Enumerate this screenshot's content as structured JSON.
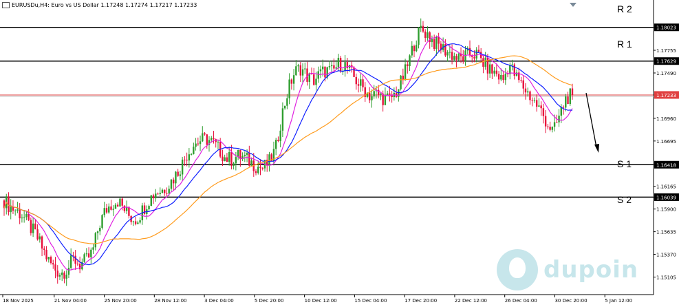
{
  "header": {
    "title": "EURUSDu,H4:  Euro vs US Dollar  1.17248 1.17274 1.17217 1.17233"
  },
  "levels": [
    {
      "label": "R 2",
      "price": 1.18023
    },
    {
      "label": "R 1",
      "price": 1.17629
    },
    {
      "label": "S 1",
      "price": 1.16418
    },
    {
      "label": "S 2",
      "price": 1.16039
    }
  ],
  "logo": {
    "text": "dupoin"
  },
  "colors": {
    "bull": "#2e9d2e",
    "bear": "#e8103c",
    "ma_fast": "#e020e0",
    "ma_mid": "#1020ff",
    "ma_slow": "#ff9c1f",
    "current_line": "#e04040",
    "level_line": "#000000"
  },
  "chart_data": {
    "type": "candlestick",
    "symbol": "EURUSDu",
    "timeframe": "H4",
    "current_price": 1.17233,
    "ohlc_last": {
      "open": 1.17248,
      "high": 1.17274,
      "low": 1.17217,
      "close": 1.17233
    },
    "ylim": [
      1.149,
      1.1823
    ],
    "y_ticks": [
      "1.18023",
      "1.17755",
      "1.17629",
      "1.17490",
      "1.17233",
      "1.16960",
      "1.16695",
      "1.16418",
      "1.16165",
      "1.16039",
      "1.15900",
      "1.15635",
      "1.15370",
      "1.15105"
    ],
    "x_ticks": [
      "18 Nov 2025",
      "21 Nov 04:00",
      "25 Nov 20:00",
      "28 Nov 12:00",
      "3 Dec 04:00",
      "5 Dec 20:00",
      "10 Dec 12:00",
      "15 Dec 04:00",
      "17 Dec 20:00",
      "22 Dec 12:00",
      "26 Dec 04:00",
      "30 Dec 20:00",
      "5 Jan 12:00"
    ],
    "close_path": [
      1.16,
      1.1592,
      1.1588,
      1.1582,
      1.157,
      1.156,
      1.1545,
      1.153,
      1.152,
      1.1515,
      1.152,
      1.1532,
      1.1525,
      1.153,
      1.154,
      1.157,
      1.1588,
      1.1596,
      1.16,
      1.159,
      1.158,
      1.1578,
      1.159,
      1.1602,
      1.161,
      1.1612,
      1.1618,
      1.1628,
      1.164,
      1.1655,
      1.1665,
      1.167,
      1.1672,
      1.1668,
      1.166,
      1.165,
      1.1648,
      1.1652,
      1.165,
      1.1645,
      1.164,
      1.1638,
      1.1645,
      1.166,
      1.17,
      1.173,
      1.175,
      1.1755,
      1.1745,
      1.174,
      1.1748,
      1.1752,
      1.175,
      1.176,
      1.1758,
      1.1748,
      1.1738,
      1.173,
      1.1722,
      1.1725,
      1.172,
      1.1718,
      1.1725,
      1.174,
      1.176,
      1.1785,
      1.18,
      1.1795,
      1.1785,
      1.178,
      1.1775,
      1.177,
      1.1765,
      1.1768,
      1.1772,
      1.177,
      1.176,
      1.1752,
      1.1748,
      1.174,
      1.176,
      1.1745,
      1.1735,
      1.1725,
      1.1715,
      1.1705,
      1.169,
      1.168,
      1.17,
      1.172,
      1.17233
    ],
    "series": [
      {
        "key": "ma_fast",
        "period": 10
      },
      {
        "key": "ma_mid",
        "period": 20
      },
      {
        "key": "ma_slow",
        "period": 50
      }
    ],
    "annotations": [
      {
        "type": "arrow",
        "direction": "down"
      }
    ]
  }
}
